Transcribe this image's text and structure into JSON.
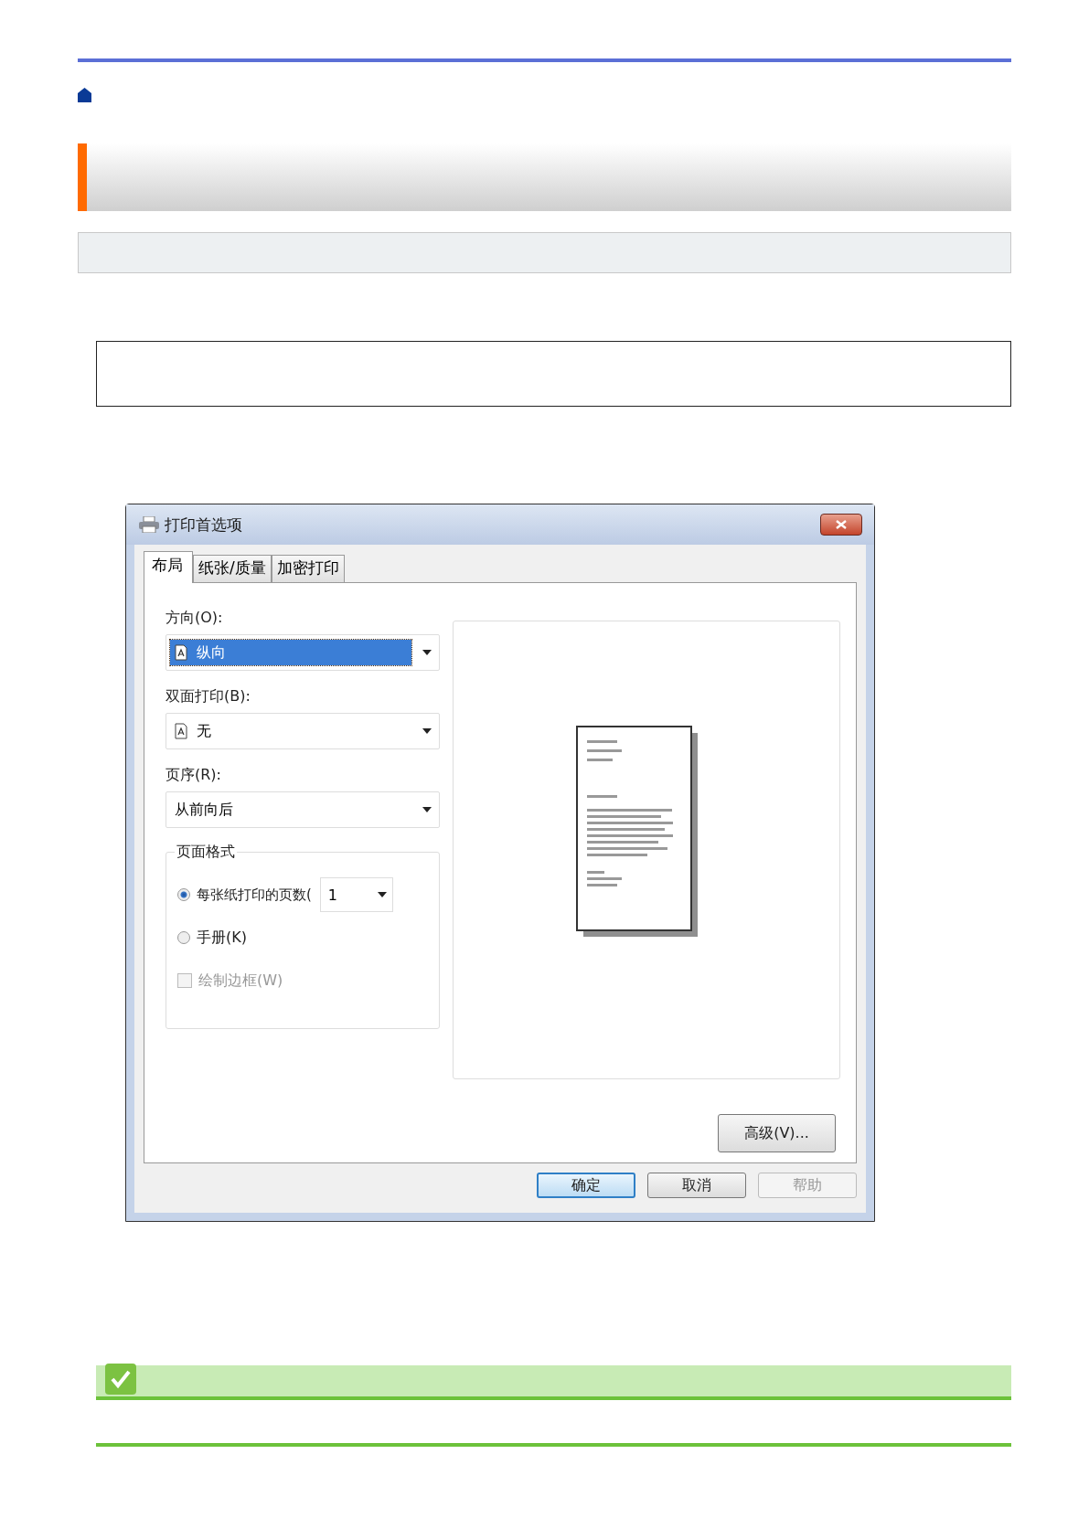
{
  "page": {
    "banner": {
      "kind": "heading"
    },
    "note": {
      "kind": "check"
    }
  },
  "dialog": {
    "title": "打印首选项",
    "tabs": [
      {
        "label": "布局",
        "selected": true
      },
      {
        "label": "纸张/质量",
        "selected": false
      },
      {
        "label": "加密打印",
        "selected": false
      }
    ],
    "fields": [
      {
        "label": "方向(O):",
        "value": "纵向",
        "kind": "page",
        "highlighted": true
      },
      {
        "label": "双面打印(B):",
        "value": "无",
        "kind": "page",
        "highlighted": false
      },
      {
        "label": "页序(R):",
        "value": "从前向后",
        "kind": "plain",
        "highlighted": false
      }
    ],
    "group": {
      "title": "页面格式",
      "options": [
        {
          "kind": "radio",
          "label": "每张纸打印的页数(",
          "selected": true,
          "disabled": false,
          "spinner": "1"
        },
        {
          "kind": "radio",
          "label": "手册(K)",
          "selected": false,
          "disabled": false
        },
        {
          "kind": "checkbox",
          "label": "绘制边框(W)",
          "checked": false,
          "disabled": true
        }
      ]
    },
    "advanced_button": "高级(V)...",
    "buttons": [
      {
        "label": "确定",
        "default": true,
        "disabled": false
      },
      {
        "label": "取消",
        "default": false,
        "disabled": false
      },
      {
        "label": "帮助",
        "default": false,
        "disabled": true
      }
    ]
  }
}
